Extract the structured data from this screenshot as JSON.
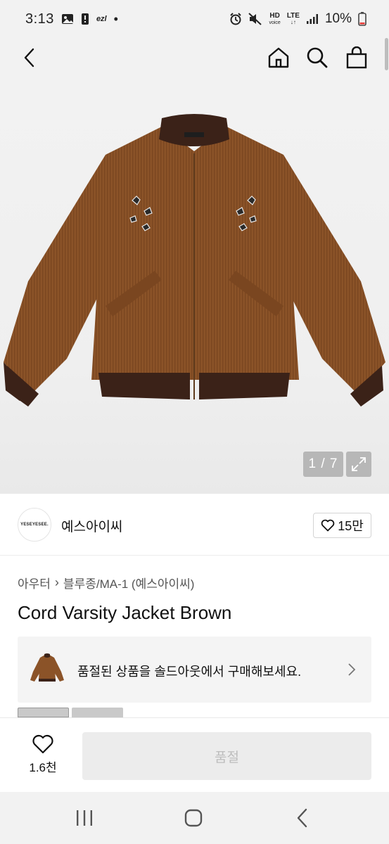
{
  "status_bar": {
    "time": "3:13",
    "carrier_app": "ezl",
    "network_top": "HD",
    "network_sub": "voice",
    "lte_label": "LTE",
    "battery": "10%"
  },
  "header": {
    "back_icon": "chevron-left-icon",
    "home_icon": "home-icon",
    "search_icon": "search-icon",
    "cart_icon": "shopping-bag-icon"
  },
  "gallery": {
    "counter": "1 / 7",
    "expand_icon": "expand-icon",
    "product_color": "#8b5328"
  },
  "brand": {
    "logo_text": "YESEYESEE.",
    "name": "예스아이씨",
    "likes": "15만"
  },
  "product": {
    "category_main": "아우터",
    "category_sub": "블루종/MA-1 (예스아이씨)",
    "title": "Cord Varsity Jacket Brown"
  },
  "soldout_banner": {
    "text": "품절된 상품을 솔드아웃에서 구매해보세요."
  },
  "action_bar": {
    "wish_count": "1.6천",
    "buy_label": "품절"
  },
  "colors": {
    "background": "#ffffff",
    "system_gray": "#f2f2f2",
    "disabled_button": "#ececec",
    "disabled_text": "#bdbdbd"
  }
}
